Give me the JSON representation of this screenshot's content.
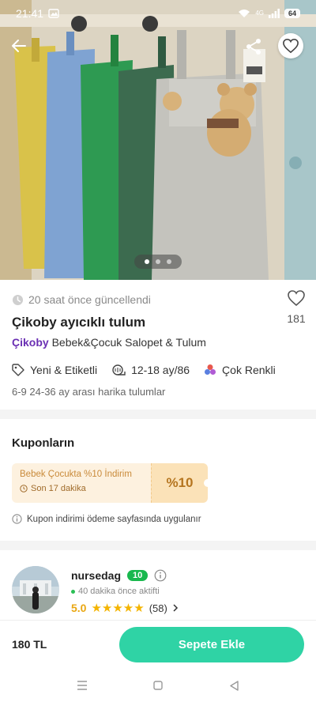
{
  "status_bar": {
    "time": "21:41",
    "battery": "64",
    "network": "4G"
  },
  "gallery": {
    "image_count": 3,
    "active_index": 0
  },
  "product": {
    "updated_text": "20 saat önce güncellendi",
    "favorite_count": "181",
    "title": "Çikoby ayıcıklı tulum",
    "brand": "Çikoby",
    "category": "Bebek&Çocuk Salopet & Tulum",
    "attributes": [
      {
        "icon": "tag-icon",
        "label": "Yeni & Etiketli"
      },
      {
        "icon": "size-icon",
        "label": "12-18 ay/86"
      },
      {
        "icon": "color-icon",
        "label": "Çok Renkli"
      }
    ],
    "description": "6-9 24-36 ay arası harika tulumlar"
  },
  "coupons": {
    "heading": "Kuponların",
    "coupon": {
      "title": "Bebek Çocukta %10 İndirim",
      "time_left": "Son 17 dakika",
      "value": "%10"
    },
    "note": "Kupon indirimi ödeme sayfasında uygulanır"
  },
  "seller": {
    "name": "nursedag",
    "badge": "10",
    "last_active": "40 dakika önce aktifti",
    "rating": "5.0",
    "stars": 5,
    "review_count": "(58)"
  },
  "purchase": {
    "price": "180 TL",
    "cart_label": "Sepete Ekle"
  },
  "colors": {
    "accent": "#2fd3a5",
    "brand": "#6a2fb3",
    "coupon_bg": "#fdf1df",
    "star": "#f4b400",
    "badge": "#19b84e"
  }
}
